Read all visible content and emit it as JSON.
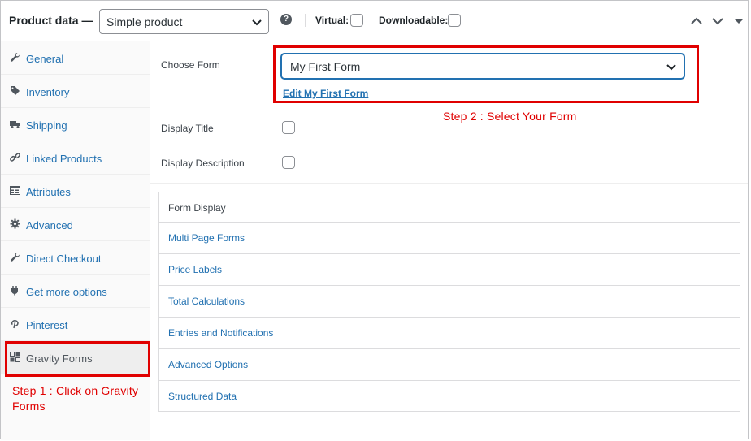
{
  "header": {
    "title": "Product data —",
    "product_type": "Simple product",
    "help_glyph": "?",
    "virtual_label": "Virtual:",
    "downloadable_label": "Downloadable:"
  },
  "sidebar": {
    "items": [
      {
        "label": "General",
        "icon": "wrench-icon"
      },
      {
        "label": "Inventory",
        "icon": "tag-icon"
      },
      {
        "label": "Shipping",
        "icon": "truck-icon"
      },
      {
        "label": "Linked Products",
        "icon": "link-icon"
      },
      {
        "label": "Attributes",
        "icon": "list-table-icon"
      },
      {
        "label": "Advanced",
        "icon": "gear-icon"
      },
      {
        "label": "Direct Checkout",
        "icon": "wrench-icon"
      },
      {
        "label": "Get more options",
        "icon": "plugin-icon"
      },
      {
        "label": "Pinterest",
        "icon": "pinterest-icon"
      },
      {
        "label": "Gravity Forms",
        "icon": "gravity-forms-icon",
        "active": true
      }
    ]
  },
  "main": {
    "choose_form_label": "Choose Form",
    "selected_form": "My First Form",
    "edit_link": "Edit My First Form",
    "display_title_label": "Display Title",
    "display_description_label": "Display Description",
    "accordion": {
      "heading": "Form Display",
      "items": [
        "Multi Page Forms",
        "Price Labels",
        "Total Calculations",
        "Entries and Notifications",
        "Advanced Options",
        "Structured Data"
      ]
    }
  },
  "annotations": {
    "step1_line1": "Step 1 : Click on Gravity",
    "step1_line2": "Forms",
    "step2": "Step 2 : Select Your Form",
    "highlight_color": "#e00000"
  },
  "colors": {
    "link": "#2271b1",
    "text": "#3c434a",
    "border": "#dcdcde"
  }
}
